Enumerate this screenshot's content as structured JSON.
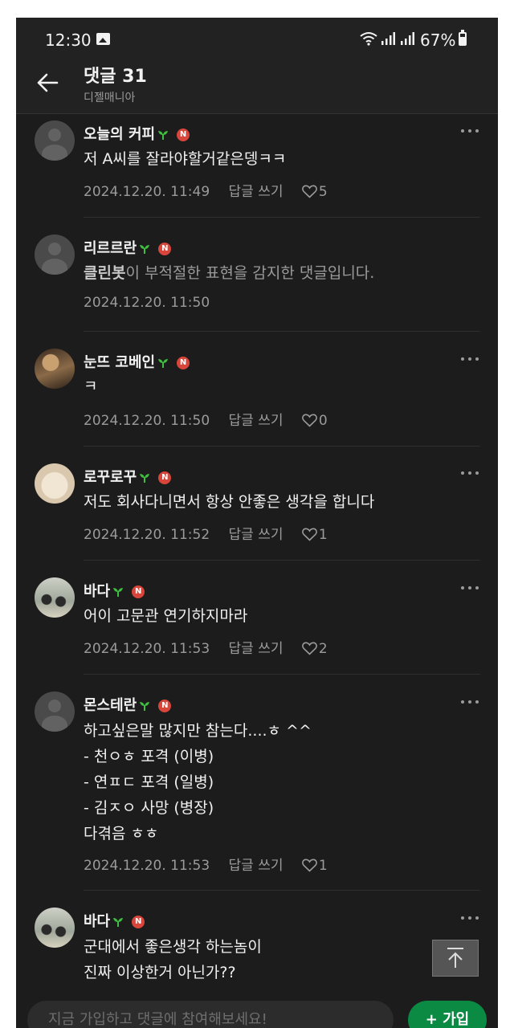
{
  "status_bar": {
    "time": "12:30",
    "battery": "67%"
  },
  "header": {
    "title": "댓글 31",
    "subtitle": "디젤매니아"
  },
  "comments": [
    {
      "author": "오늘의 커피",
      "lines": [
        "저 A씨를 잘라야할거같은뎅ㅋㅋ"
      ],
      "date": "2024.12.20. 11:49",
      "reply": "답글 쓰기",
      "likes": "5",
      "avatar": "default"
    },
    {
      "author": "리르르란",
      "filter_bot": "클린봇",
      "filter_text": "이 부적절한 표현을 감지한 댓글입니다.",
      "date": "2024.12.20. 11:50",
      "avatar": "default"
    },
    {
      "author": "눈뜨 코베인",
      "lines": [
        "ㅋ"
      ],
      "date": "2024.12.20. 11:50",
      "reply": "답글 쓰기",
      "likes": "0",
      "avatar": "photo-guitar"
    },
    {
      "author": "로꾸로꾸",
      "lines": [
        "저도 회사다니면서 항상 안좋은 생각을 합니다"
      ],
      "date": "2024.12.20. 11:52",
      "reply": "답글 쓰기",
      "likes": "1",
      "avatar": "photo-dog"
    },
    {
      "author": "바다",
      "lines": [
        "어이 고문관 연기하지마라"
      ],
      "date": "2024.12.20. 11:53",
      "reply": "답글 쓰기",
      "likes": "2",
      "avatar": "photo-sea"
    },
    {
      "author": "몬스테란",
      "lines": [
        "하고싶은말 많지만 참는다....ㅎ ^^",
        "- 천ㅇㅎ 포격 (이병)",
        "- 연ㅍㄷ 포격 (일병)",
        "- 김ㅈㅇ 사망 (병장)",
        "다겪음 ㅎㅎ"
      ],
      "date": "2024.12.20. 11:53",
      "reply": "답글 쓰기",
      "likes": "1",
      "avatar": "default"
    },
    {
      "author": "바다",
      "lines": [
        "군대에서 좋은생각 하는놈이",
        "진짜 이상한거 아닌가??"
      ],
      "avatar": "photo-sea"
    }
  ],
  "badge_letter": "N",
  "bottom": {
    "input_placeholder": "지금 가입하고 댓글에 참여해보세요!",
    "join_label": "+ 가입"
  }
}
